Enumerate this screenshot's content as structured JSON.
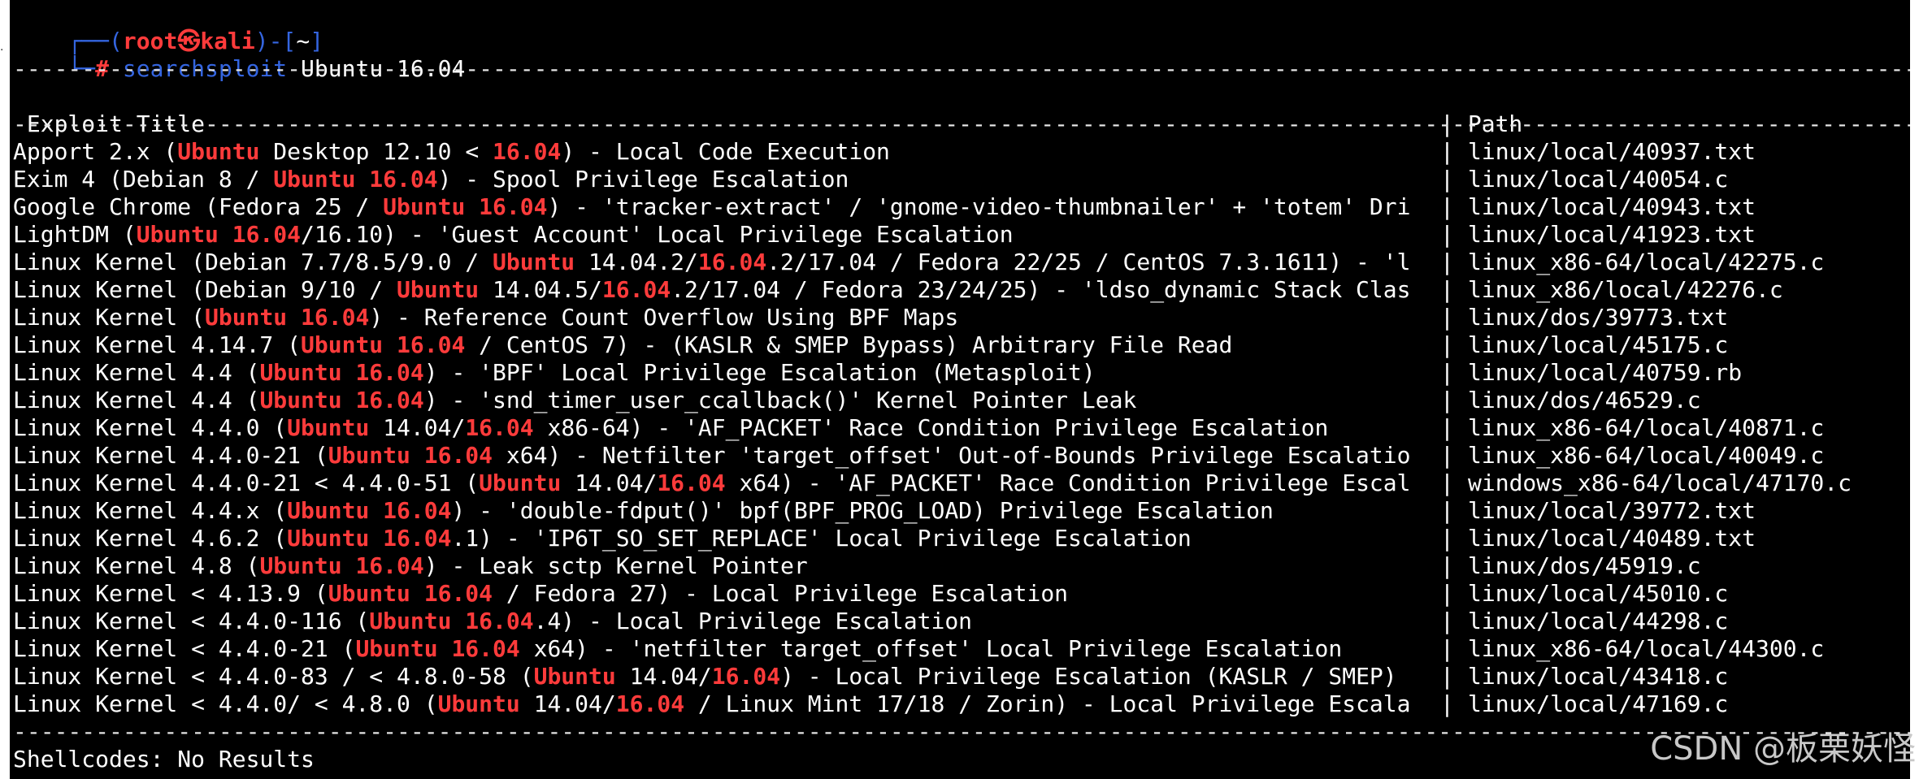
{
  "prompt": {
    "corner_top": "┌──",
    "corner_bottom": "└─",
    "open": "(",
    "user": "root",
    "at_symbol": "㉿",
    "host": "kali",
    "close": ")-[",
    "dir": "~",
    "dir_close": "]",
    "hash": "#",
    "command": "searchsploit",
    "argument": " Ubuntu 16.04"
  },
  "separator": "------------------------------------------------------------------------------------------------------------------------------------------------------------------------------------------------------------------------------------------------------------------------------------------------",
  "header": {
    "title_col": " Exploit Title",
    "divider": "|",
    "path_col": " Path"
  },
  "rows": [
    {
      "segments": [
        "Apport 2.x (",
        "Ubuntu",
        " Desktop 12.10 < ",
        "16.04",
        ") - Local Code Execution"
      ],
      "path": "linux/local/40937.txt"
    },
    {
      "segments": [
        "Exim 4 (Debian 8 / ",
        "Ubuntu 16.04",
        ") - Spool Privilege Escalation"
      ],
      "path": "linux/local/40054.c"
    },
    {
      "segments": [
        "Google Chrome (Fedora 25 / ",
        "Ubuntu 16.04",
        ") - 'tracker-extract' / 'gnome-video-thumbnailer' + 'totem' Dri"
      ],
      "path": "linux/local/40943.txt"
    },
    {
      "segments": [
        "LightDM (",
        "Ubuntu 16.04",
        "/16.10) - 'Guest Account' Local Privilege Escalation"
      ],
      "path": "linux/local/41923.txt"
    },
    {
      "segments": [
        "Linux Kernel (Debian 7.7/8.5/9.0 / ",
        "Ubuntu",
        " 14.04.2/",
        "16.04",
        ".2/17.04 / Fedora 22/25 / CentOS 7.3.1611) - 'l"
      ],
      "path": "linux_x86-64/local/42275.c"
    },
    {
      "segments": [
        "Linux Kernel (Debian 9/10 / ",
        "Ubuntu",
        " 14.04.5/",
        "16.04",
        ".2/17.04 / Fedora 23/24/25) - 'ldso_dynamic Stack Clas"
      ],
      "path": "linux_x86/local/42276.c"
    },
    {
      "segments": [
        "Linux Kernel (",
        "Ubuntu 16.04",
        ") - Reference Count Overflow Using BPF Maps"
      ],
      "path": "linux/dos/39773.txt"
    },
    {
      "segments": [
        "Linux Kernel 4.14.7 (",
        "Ubuntu 16.04",
        " / CentOS 7) - (KASLR & SMEP Bypass) Arbitrary File Read"
      ],
      "path": "linux/local/45175.c"
    },
    {
      "segments": [
        "Linux Kernel 4.4 (",
        "Ubuntu 16.04",
        ") - 'BPF' Local Privilege Escalation (Metasploit)"
      ],
      "path": "linux/local/40759.rb"
    },
    {
      "segments": [
        "Linux Kernel 4.4 (",
        "Ubuntu 16.04",
        ") - 'snd_timer_user_ccallback()' Kernel Pointer Leak"
      ],
      "path": "linux/dos/46529.c"
    },
    {
      "segments": [
        "Linux Kernel 4.4.0 (",
        "Ubuntu",
        " 14.04/",
        "16.04",
        " x86-64) - 'AF_PACKET' Race Condition Privilege Escalation"
      ],
      "path": "linux_x86-64/local/40871.c"
    },
    {
      "segments": [
        "Linux Kernel 4.4.0-21 (",
        "Ubuntu 16.04",
        " x64) - Netfilter 'target_offset' Out-of-Bounds Privilege Escalatio"
      ],
      "path": "linux_x86-64/local/40049.c"
    },
    {
      "segments": [
        "Linux Kernel 4.4.0-21 < 4.4.0-51 (",
        "Ubuntu",
        " 14.04/",
        "16.04",
        " x64) - 'AF_PACKET' Race Condition Privilege Escal"
      ],
      "path": "windows_x86-64/local/47170.c"
    },
    {
      "segments": [
        "Linux Kernel 4.4.x (",
        "Ubuntu 16.04",
        ") - 'double-fdput()' bpf(BPF_PROG_LOAD) Privilege Escalation"
      ],
      "path": "linux/local/39772.txt"
    },
    {
      "segments": [
        "Linux Kernel 4.6.2 (",
        "Ubuntu 16.04",
        ".1) - 'IP6T_SO_SET_REPLACE' Local Privilege Escalation"
      ],
      "path": "linux/local/40489.txt"
    },
    {
      "segments": [
        "Linux Kernel 4.8 (",
        "Ubuntu 16.04",
        ") - Leak sctp Kernel Pointer"
      ],
      "path": "linux/dos/45919.c"
    },
    {
      "segments": [
        "Linux Kernel < 4.13.9 (",
        "Ubuntu 16.04",
        " / Fedora 27) - Local Privilege Escalation"
      ],
      "path": "linux/local/45010.c"
    },
    {
      "segments": [
        "Linux Kernel < 4.4.0-116 (",
        "Ubuntu 16.04",
        ".4) - Local Privilege Escalation"
      ],
      "path": "linux/local/44298.c"
    },
    {
      "segments": [
        "Linux Kernel < 4.4.0-21 (",
        "Ubuntu 16.04",
        " x64) - 'netfilter target_offset' Local Privilege Escalation"
      ],
      "path": "linux_x86-64/local/44300.c"
    },
    {
      "segments": [
        "Linux Kernel < 4.4.0-83 / < 4.8.0-58 (",
        "Ubuntu",
        " 14.04/",
        "16.04",
        ") - Local Privilege Escalation (KASLR / SMEP)"
      ],
      "path": "linux/local/43418.c"
    },
    {
      "segments": [
        "Linux Kernel < 4.4.0/ < 4.8.0 (",
        "Ubuntu",
        " 14.04/",
        "16.04",
        " / Linux Mint 17/18 / Zorin) - Local Privilege Escala"
      ],
      "path": "linux/local/47169.c"
    }
  ],
  "shellcodes": "Shellcodes: No Results",
  "watermark": "CSDN @板栗妖怪",
  "colors": {
    "background": "#000000",
    "text": "#ffffff",
    "prompt_blue": "#3465e0",
    "highlight_red": "#ff3b3b"
  }
}
